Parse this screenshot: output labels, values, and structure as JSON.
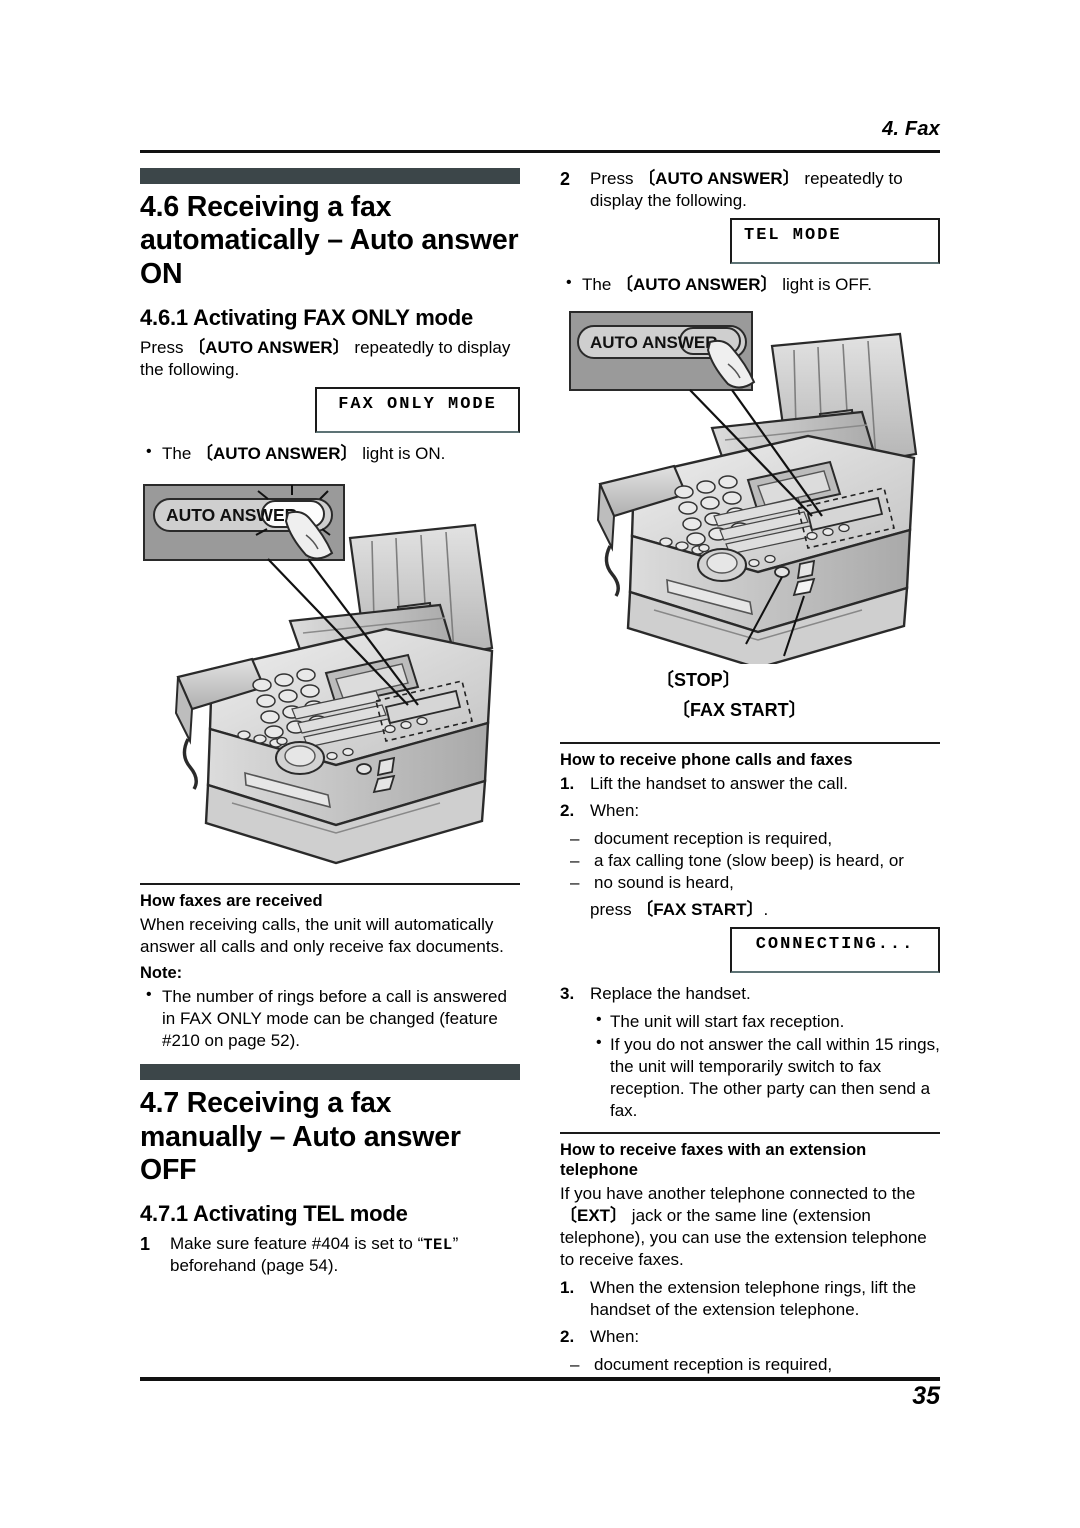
{
  "header": {
    "running_head": "4. Fax"
  },
  "footer": {
    "page_number": "35"
  },
  "left_column": {
    "section": {
      "title": "4.6 Receiving a fax automatically – Auto answer ON",
      "subsection_title": "4.6.1 Activating FAX ONLY mode",
      "intro": "Press [AUTO ANSWER] repeatedly to display the following.",
      "intro_pre": "Press ",
      "intro_key": "〔AUTO ANSWER〕",
      "intro_post": " repeatedly to display the following.",
      "lcd_display": "FAX ONLY MODE",
      "bullet_pre": "The ",
      "bullet_key": "〔AUTO ANSWER〕",
      "bullet_post": " light is ON."
    },
    "figure": {
      "callout_label": "AUTO ANSWER",
      "alt": "Fax machine with AUTO ANSWER button callout, light blinking"
    },
    "how_faxes": {
      "heading": "How faxes are received",
      "body": "When receiving calls, the unit will automatically answer all calls and only receive fax documents.",
      "note_heading": "Note:",
      "note_bullet": "The number of rings before a call is answered in FAX ONLY mode can be changed (feature #210 on page 52)."
    },
    "section2": {
      "title": "4.7 Receiving a fax manually – Auto answer OFF",
      "subsection_title": "4.7.1 Activating TEL mode",
      "step1_num": "1",
      "step1_pre": "Make sure feature #404 is set to “",
      "step1_mono": "TEL",
      "step1_post": "” beforehand (page 54)."
    }
  },
  "right_column": {
    "step2": {
      "num": "2",
      "pre": "Press ",
      "key": "〔AUTO ANSWER〕",
      "post": " repeatedly to display the following."
    },
    "lcd_display": "TEL MODE",
    "bullet_pre": "The ",
    "bullet_key": "〔AUTO ANSWER〕",
    "bullet_post": " light is OFF.",
    "figure": {
      "callout_label": "AUTO ANSWER",
      "button_label_stop": "〔STOP〕",
      "button_label_faxstart": "〔FAX START〕",
      "alt": "Fax machine with AUTO ANSWER callout and STOP / FAX START button pointers"
    },
    "how_receive": {
      "heading": "How to receive phone calls and faxes",
      "step1_num": "1.",
      "step1": "Lift the handset to answer the call.",
      "step2_num": "2.",
      "step2": "When:",
      "dash1": "document reception is required,",
      "dash2": "a fax calling tone (slow beep) is heard, or",
      "dash3": "no sound is heard,",
      "press_pre": "press ",
      "press_key": "〔FAX START〕",
      "press_post": ".",
      "lcd_display": "CONNECTING...",
      "step3_num": "3.",
      "step3": "Replace the handset.",
      "step3_bullet1": "The unit will start fax reception.",
      "step3_bullet2": "If you do not answer the call within 15 rings, the unit will temporarily switch to fax reception. The other party can then send a fax."
    },
    "how_extension": {
      "heading": "How to receive faxes with an extension telephone",
      "intro_pre": "If you have another telephone connected to the ",
      "intro_key": "〔EXT〕",
      "intro_post": " jack or the same line (extension telephone), you can use the extension telephone to receive faxes.",
      "step1_num": "1.",
      "step1": "When the extension telephone rings, lift the handset of the extension telephone.",
      "step2_num": "2.",
      "step2": "When:",
      "dash1": "document reception is required,"
    }
  },
  "colors": {
    "section_bar": "#3c4649",
    "rule": "#111111",
    "lcd_border": "#1a1a1a",
    "lcd_border_bottom": "#5d7375",
    "callout_box": "#9a9a9a"
  }
}
